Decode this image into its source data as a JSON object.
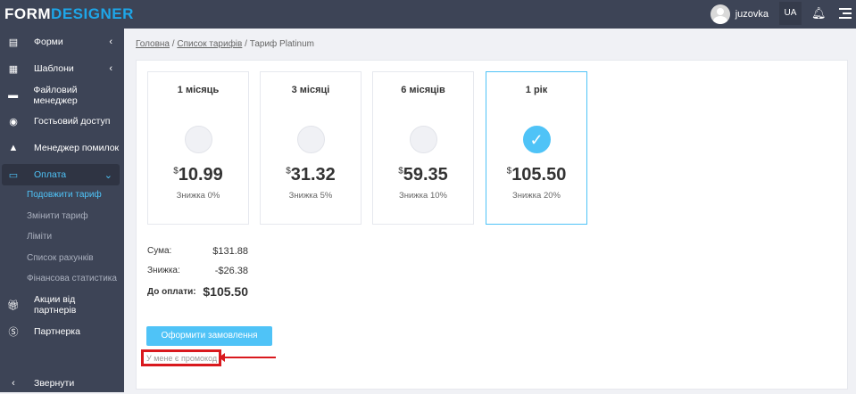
{
  "header": {
    "logo_a": "FORM",
    "logo_b": "DESIGNER",
    "username": "juzovka",
    "lang": "UA"
  },
  "sidebar": {
    "items": [
      {
        "label": "Форми",
        "icon": "forms-icon"
      },
      {
        "label": "Шаблони",
        "icon": "templates-icon"
      },
      {
        "label": "Файловий менеджер",
        "icon": "file-manager-icon"
      },
      {
        "label": "Гостьовий доступ",
        "icon": "guest-icon"
      },
      {
        "label": "Менеджер помилок",
        "icon": "warning-icon"
      },
      {
        "label": "Оплата",
        "icon": "card-icon"
      },
      {
        "label": "Акции від партнерів",
        "icon": "gift-icon"
      },
      {
        "label": "Партнерка",
        "icon": "dollar-icon"
      },
      {
        "label": "Звернути",
        "icon": "chevron-left-icon"
      }
    ],
    "subitems": [
      "Подовжити тариф",
      "Змінити тариф",
      "Ліміти",
      "Список рахунків",
      "Фінансова статистика"
    ]
  },
  "breadcrumb": {
    "home": "Головна",
    "list": "Список тарифів",
    "current": "Тариф Platinum"
  },
  "plans": [
    {
      "title": "1 місяць",
      "currency": "$",
      "price": "10.99",
      "discount": "Знижка 0%",
      "selected": false
    },
    {
      "title": "3 місяці",
      "currency": "$",
      "price": "31.32",
      "discount": "Знижка 5%",
      "selected": false
    },
    {
      "title": "6 місяців",
      "currency": "$",
      "price": "59.35",
      "discount": "Знижка 10%",
      "selected": false
    },
    {
      "title": "1 рік",
      "currency": "$",
      "price": "105.50",
      "discount": "Знижка 20%",
      "selected": true
    }
  ],
  "summary": {
    "sum_label": "Сума:",
    "sum": "$131.88",
    "discount_label": "Знижка:",
    "discount": "-$26.38",
    "total_label": "До оплати:",
    "total": "$105.50"
  },
  "order_button": "Оформити замовлення",
  "promo_link": "У мене є промокод",
  "colors": {
    "accent": "#4fc3f7",
    "highlight": "#d9191e",
    "sidebar": "#3d4456"
  }
}
